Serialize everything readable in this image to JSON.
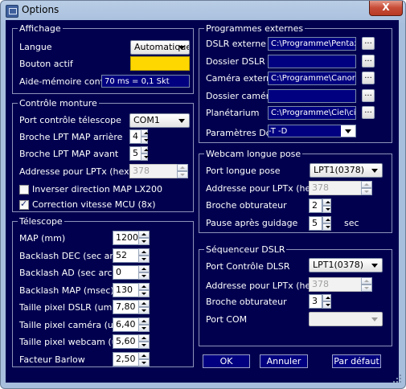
{
  "window": {
    "title": "Options",
    "close_label": "X"
  },
  "affichage": {
    "legend": "Affichage",
    "langue_label": "Langue",
    "langue_value": "Automatique",
    "bouton_actif_label": "Bouton actif",
    "bouton_actif_color": "#ffd700",
    "aide_label": "Aide-mémoire conversion",
    "aide_value": "70 ms = 0,1 Skt"
  },
  "controle": {
    "legend": "Contrôle monture",
    "port_label": "Port contrôle télescope",
    "port_value": "COM1",
    "lpt_arriere_label": "Broche LPT MAP arrière",
    "lpt_arriere_value": "4",
    "lpt_avant_label": "Broche LPT MAP avant",
    "lpt_avant_value": "5",
    "adresse_label": "Addresse pour LPTx (hex)",
    "adresse_value": "378",
    "inverser_label": "Inverser direction MAP LX200",
    "inverser_checked": false,
    "correction_label": "Correction vitesse MCU (8x)",
    "correction_checked": true,
    "check_mark": "✓"
  },
  "telescope": {
    "legend": "Télescope",
    "rows": [
      {
        "label": "MAP (mm)",
        "value": "1200"
      },
      {
        "label": "Backlash DEC (sec arc)",
        "value": "52"
      },
      {
        "label": "Backlash AD (sec arc)",
        "value": "0"
      },
      {
        "label": "Backlash MAP (msec)",
        "value": "130"
      },
      {
        "label": "Taille pixel DSLR (um)",
        "value": "7,80"
      },
      {
        "label": "Taille pixel caméra (um)",
        "value": "6,40"
      },
      {
        "label": "Taille pixel webcam (um)",
        "value": "5,60"
      },
      {
        "label": "Facteur Barlow",
        "value": "2,50"
      }
    ]
  },
  "programmes": {
    "legend": "Programmes externes",
    "browse_label": "...",
    "rows": [
      {
        "label": "DSLR externe",
        "value": "C:\\Programme\\Pentax\\Dig"
      },
      {
        "label": "Dossier DSLR",
        "value": ""
      },
      {
        "label": "Caméra externe",
        "value": "C:\\Programme\\Canon\\EOS"
      },
      {
        "label": "Dossier caméra",
        "value": ""
      },
      {
        "label": "Planétarium",
        "value": "C:\\Programme\\Ciel\\ciel.exe"
      }
    ],
    "dcraw_label": "Paramètres Dcraw",
    "dcraw_value": "-T -D"
  },
  "webcam": {
    "legend": "Webcam longue pose",
    "port_label": "Port longue pose",
    "port_value": "LPT1(0378)",
    "adresse_label": "Addresse pour LPTx (hex)",
    "adresse_value": "378",
    "broche_label": "Broche obturateur",
    "broche_value": "2",
    "pause_label": "Pause après guidage",
    "pause_value": "5",
    "pause_unit": "sec"
  },
  "sequenceur": {
    "legend": "Séquenceur DSLR",
    "port_label": "Port Contrôle DLSR",
    "port_value": "LPT1(0378)",
    "adresse_label": "Addresse pour LPTx (hex)",
    "adresse_value": "378",
    "broche_label": "Broche obturateur",
    "broche_value": "3",
    "com_label": "Port COM",
    "com_value": ""
  },
  "buttons": {
    "ok": "OK",
    "annuler": "Annuler",
    "defaut": "Par défaut"
  }
}
